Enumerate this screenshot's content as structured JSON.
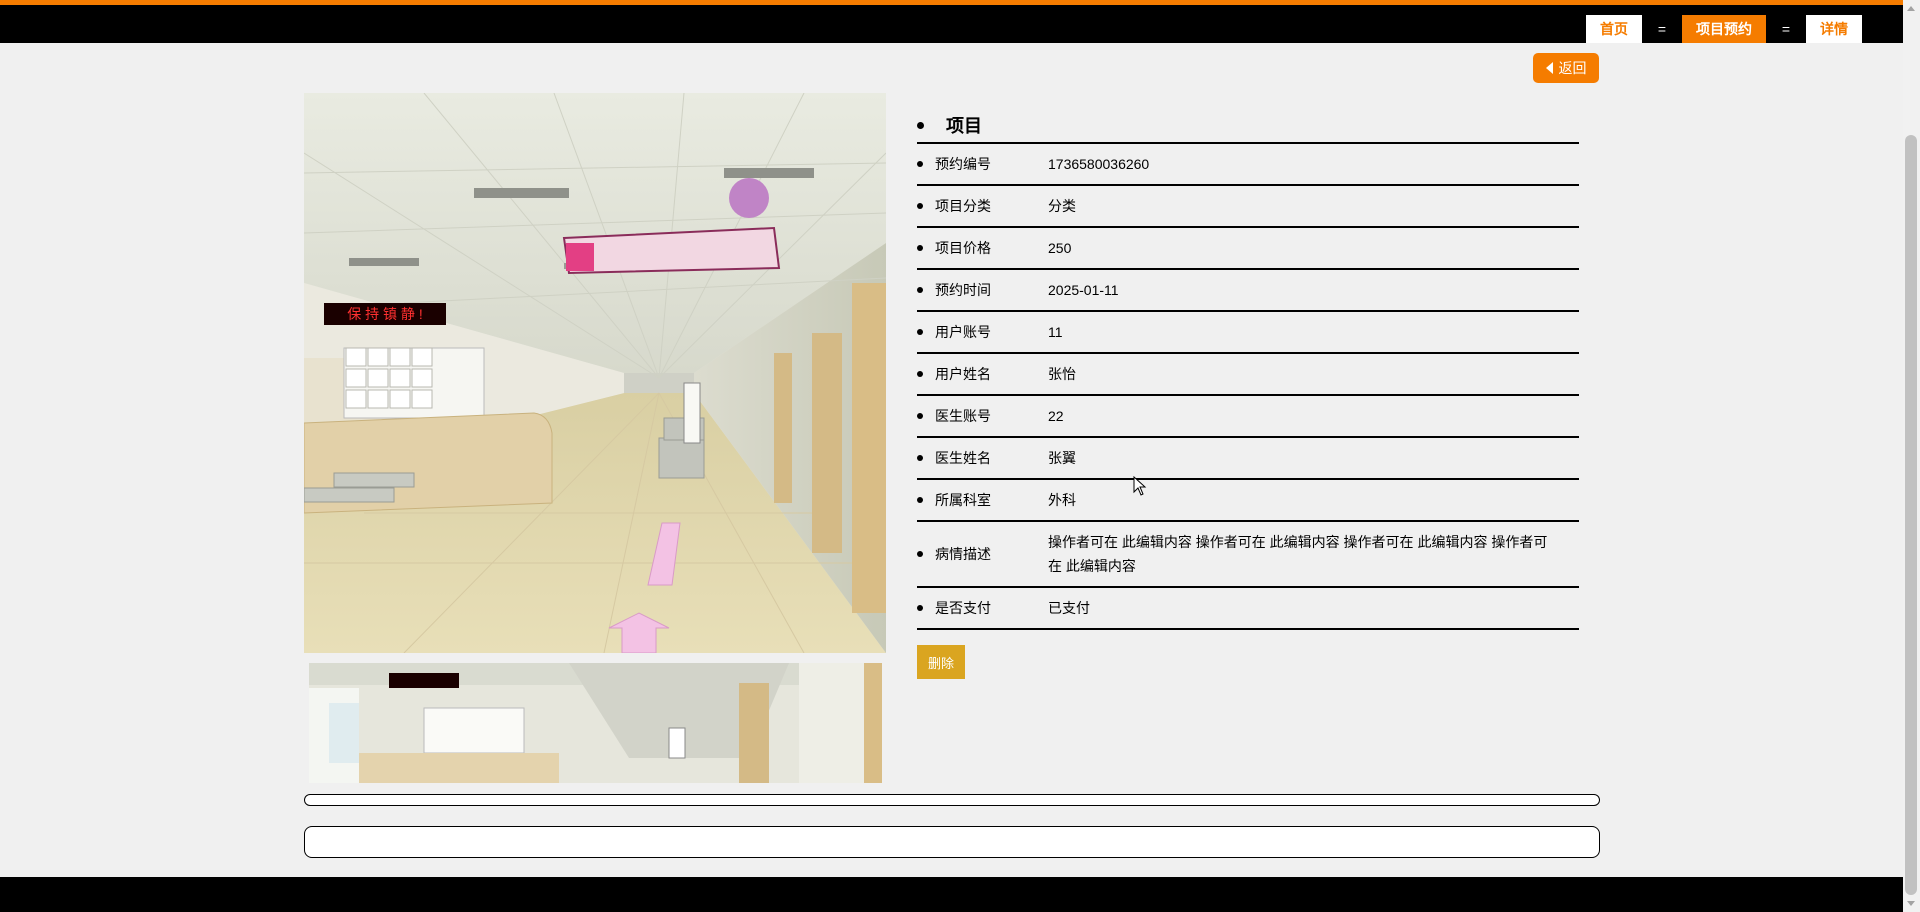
{
  "nav": {
    "items": [
      {
        "label": "首页",
        "active": false
      },
      {
        "label": "项目预约",
        "active": true
      },
      {
        "label": "详情",
        "active": false
      }
    ],
    "separator": "="
  },
  "back_label": "返回",
  "sign_text": "保 持 镇 静 !",
  "details": {
    "title": "项目",
    "rows": [
      {
        "label": "预约编号",
        "value": "1736580036260"
      },
      {
        "label": "项目分类",
        "value": "分类"
      },
      {
        "label": "项目价格",
        "value": "250"
      },
      {
        "label": "预约时间",
        "value": "2025-01-11"
      },
      {
        "label": "用户账号",
        "value": "11"
      },
      {
        "label": "用户姓名",
        "value": "张怡"
      },
      {
        "label": "医生账号",
        "value": "22"
      },
      {
        "label": "医生姓名",
        "value": "张翼"
      },
      {
        "label": "所属科室",
        "value": "外科"
      },
      {
        "label": "病情描述",
        "value": "操作者可在 此编辑内容 操作者可在 此编辑内容 操作者可在 此编辑内容 操作者可在 此编辑内容"
      },
      {
        "label": "是否支付",
        "value": "已支付"
      }
    ]
  },
  "delete_label": "删除",
  "colors": {
    "accent": "#f57c00",
    "delete": "#daa520",
    "bar": "#000000"
  }
}
